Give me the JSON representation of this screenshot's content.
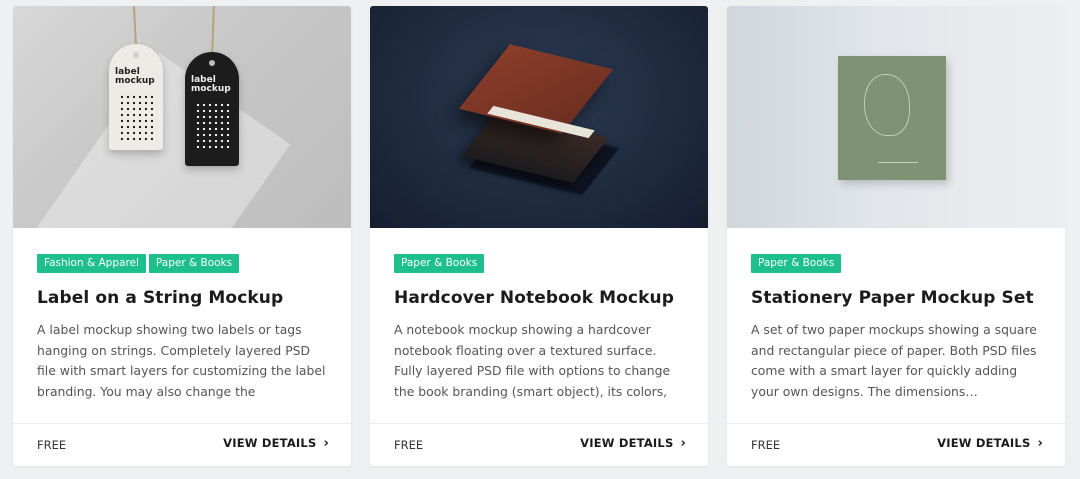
{
  "cards": [
    {
      "tags": [
        "Fashion & Apparel",
        "Paper & Books"
      ],
      "title": "Label on a String Mockup",
      "description": "A label mockup showing two labels or tags hanging on strings. Completely layered PSD file with smart layers for customizing the label branding. You may also change the background color.",
      "price": "FREE",
      "cta": "VIEW DETAILS",
      "image": {
        "label_top": "label",
        "label_bottom": "mockup"
      }
    },
    {
      "tags": [
        "Paper & Books"
      ],
      "title": "Hardcover Notebook Mockup",
      "description": "A notebook mockup showing a hardcover notebook floating over a textured surface. Fully layered PSD file with options to change the book branding (smart object), its colors, the background color…",
      "price": "FREE",
      "cta": "VIEW DETAILS"
    },
    {
      "tags": [
        "Paper & Books"
      ],
      "title": "Stationery Paper Mockup Set",
      "description": "A set of two paper mockups showing a square and rectangular piece of paper. Both PSD files come with a smart layer for quickly adding your own designs. The dimensions…",
      "price": "FREE",
      "cta": "VIEW DETAILS"
    }
  ],
  "colors": {
    "tag_bg": "#1dbf8a",
    "page_bg": "#eef0f2"
  }
}
